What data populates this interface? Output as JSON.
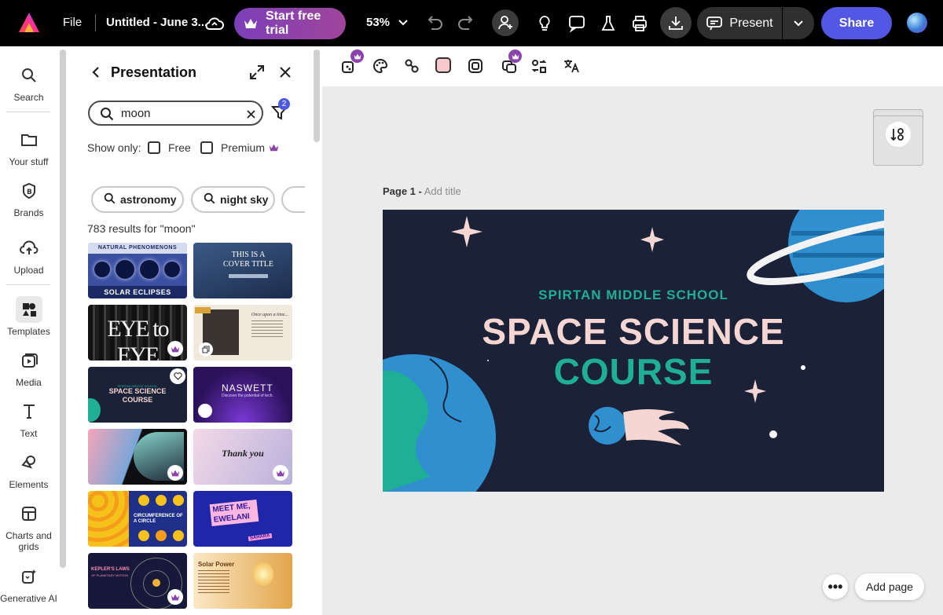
{
  "topbar": {
    "file_label": "File",
    "doc_title": "Untitled - June 3...",
    "trial_label": "Start free trial",
    "zoom": "53%",
    "present_label": "Present",
    "share_label": "Share",
    "brand_color": "#5258e4",
    "trial_color": "#8b43ad"
  },
  "sidebar": {
    "items": [
      {
        "label": "Search",
        "icon": "search-icon"
      },
      {
        "label": "Your stuff",
        "icon": "folder-icon"
      },
      {
        "label": "Brands",
        "icon": "brand-icon"
      },
      {
        "label": "Upload",
        "icon": "upload-icon"
      },
      {
        "label": "Templates",
        "icon": "templates-icon"
      },
      {
        "label": "Media",
        "icon": "media-icon"
      },
      {
        "label": "Text",
        "icon": "text-icon"
      },
      {
        "label": "Elements",
        "icon": "elements-icon"
      },
      {
        "label": "Charts and grids",
        "icon": "charts-icon"
      },
      {
        "label": "Generative AI",
        "icon": "generative-ai-icon"
      }
    ],
    "active": "Templates"
  },
  "panel": {
    "title": "Presentation",
    "search_value": "moon",
    "filter_count": "2",
    "show_only_label": "Show only:",
    "free_label": "Free",
    "premium_label": "Premium",
    "chips": [
      "astronomy",
      "night sky"
    ],
    "results_text": "783 results for \"moon\"",
    "thumbnails": [
      {
        "title": "NATURAL PHENOMENONS",
        "subtitle": "SOLAR ECLIPSES",
        "premium": false
      },
      {
        "title": "THIS IS A COVER TITLE",
        "premium": false
      },
      {
        "title": "EYE to EYE",
        "premium": true
      },
      {
        "title": "Once upon a time...",
        "premium": false
      },
      {
        "title": "SPACE SCIENCE COURSE",
        "subtitle": "SPIRTAN MIDDLE SCHOOL",
        "premium": false
      },
      {
        "title": "NASWETT",
        "subtitle": "Discover the potential of tech.",
        "premium": false
      },
      {
        "title": "",
        "premium": true
      },
      {
        "title": "Thank you",
        "premium": true
      },
      {
        "title": "CIRCUMFERENCE OF A CIRCLE",
        "premium": false
      },
      {
        "title": "MEET ME, EWELANI",
        "subtitle": "SAHARA",
        "premium": false
      },
      {
        "title": "KEPLER'S LAWS",
        "subtitle": "OF PLANETARY MOTION",
        "premium": true
      },
      {
        "title": "Solar Power",
        "premium": false
      }
    ]
  },
  "canvas": {
    "page_label": "Page 1 -",
    "add_title": "Add title",
    "slide": {
      "school": "SPIRTAN MIDDLE SCHOOL",
      "line1": "SPACE SCIENCE",
      "line2": "COURSE",
      "bg_color": "#1b2238",
      "accent_teal": "#1fae96",
      "accent_pink": "#f6d6d2"
    },
    "more_label": "•••",
    "add_page_label": "Add page"
  }
}
